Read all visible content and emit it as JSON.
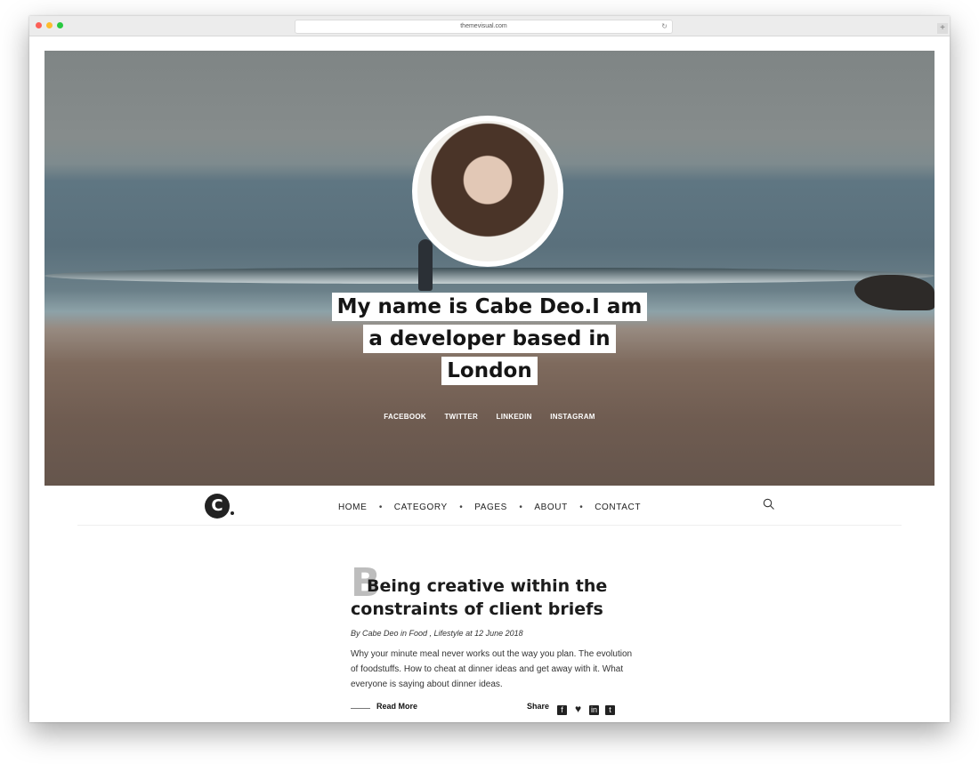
{
  "browser": {
    "url": "themevisual.com"
  },
  "hero": {
    "title_lines": [
      "My name is Cabe Deo.I am",
      "a developer based in",
      "London"
    ],
    "social": [
      "FACEBOOK",
      "TWITTER",
      "LINKEDIN",
      "INSTAGRAM"
    ]
  },
  "nav": {
    "logo": "C",
    "items": [
      "HOME",
      "CATEGORY",
      "PAGES",
      "ABOUT",
      "CONTACT"
    ],
    "separator": "•"
  },
  "post": {
    "dropcap": "B",
    "title_line1": "Being creative within the",
    "title_line2": "constraints of client briefs",
    "meta": "By Cabe Deo in Food , Lifestyle at 12 June 2018",
    "excerpt": "Why your minute meal never works out the way you plan. The evolution of foodstuffs. How to cheat at dinner ideas and get away with it. What everyone is saying about dinner ideas.",
    "read_more": "Read More",
    "share_label": "Share",
    "share_icons": [
      "facebook-icon",
      "heart-icon",
      "linkedin-icon",
      "twitter-icon"
    ]
  }
}
